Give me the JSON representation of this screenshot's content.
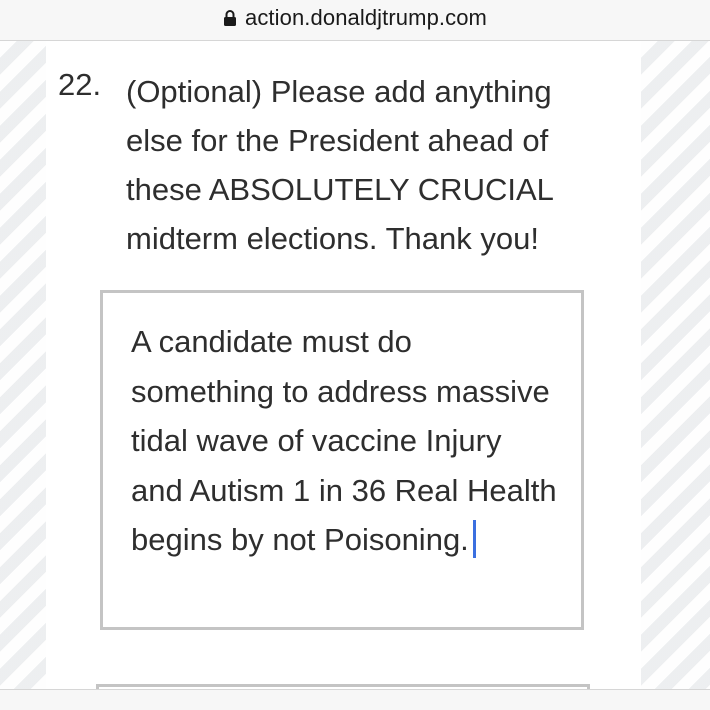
{
  "browser": {
    "url": "action.donaldjtrump.com",
    "lock_icon": "lock-icon"
  },
  "question": {
    "number": "22.",
    "text": "(Optional) Please add anything else for the President ahead of these ABSOLUTELY CRUCIAL midterm elections. Thank you!"
  },
  "answer": {
    "value": "A candidate must do something to address massive tidal wave of vaccine Injury and Autism 1 in 36 Real Health begins by not Poisoning."
  },
  "colors": {
    "caret": "#3b6fe0",
    "text": "#2e2e2e",
    "border": "#c4c4c4"
  }
}
